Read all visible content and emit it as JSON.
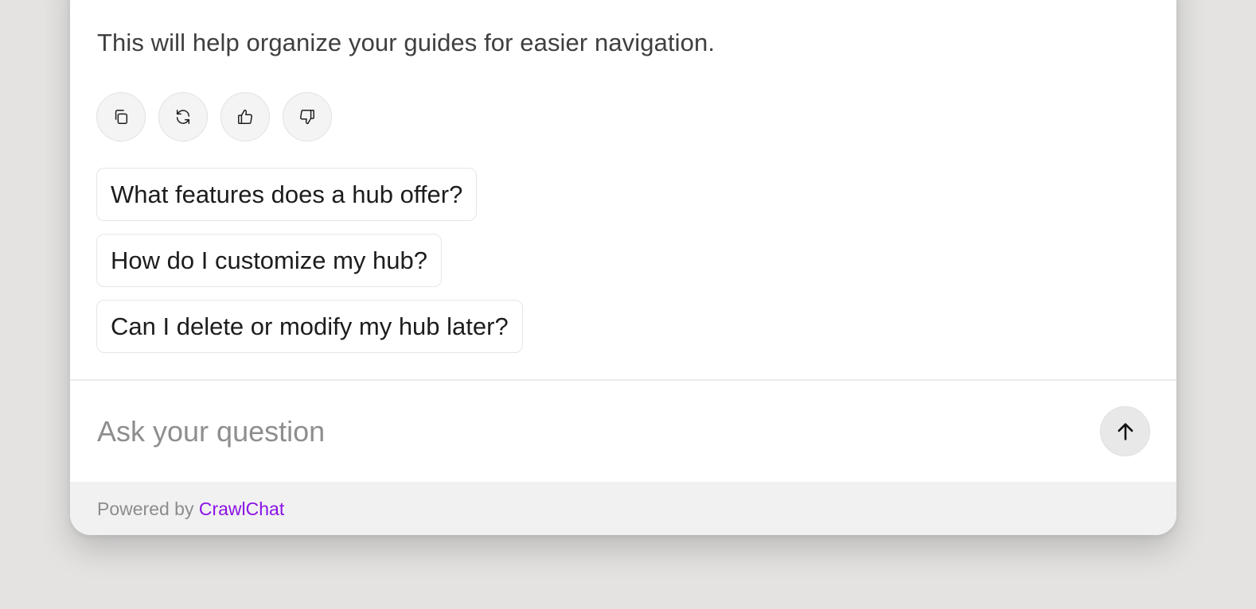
{
  "message": {
    "text": "This will help organize your guides for easier navigation."
  },
  "actions": [
    {
      "name": "copy",
      "icon": "copy-icon"
    },
    {
      "name": "regenerate",
      "icon": "refresh-icon"
    },
    {
      "name": "like",
      "icon": "thumbs-up-icon"
    },
    {
      "name": "dislike",
      "icon": "thumbs-down-icon"
    }
  ],
  "suggestions": [
    "What features does a hub offer?",
    "How do I customize my hub?",
    "Can I delete or modify my hub later?"
  ],
  "input": {
    "placeholder": "Ask your question",
    "value": ""
  },
  "send_button": {
    "icon": "arrow-up-icon"
  },
  "footer": {
    "prefix": "Powered by ",
    "brand": "CrawlChat",
    "brand_color": "#8a12e6"
  }
}
